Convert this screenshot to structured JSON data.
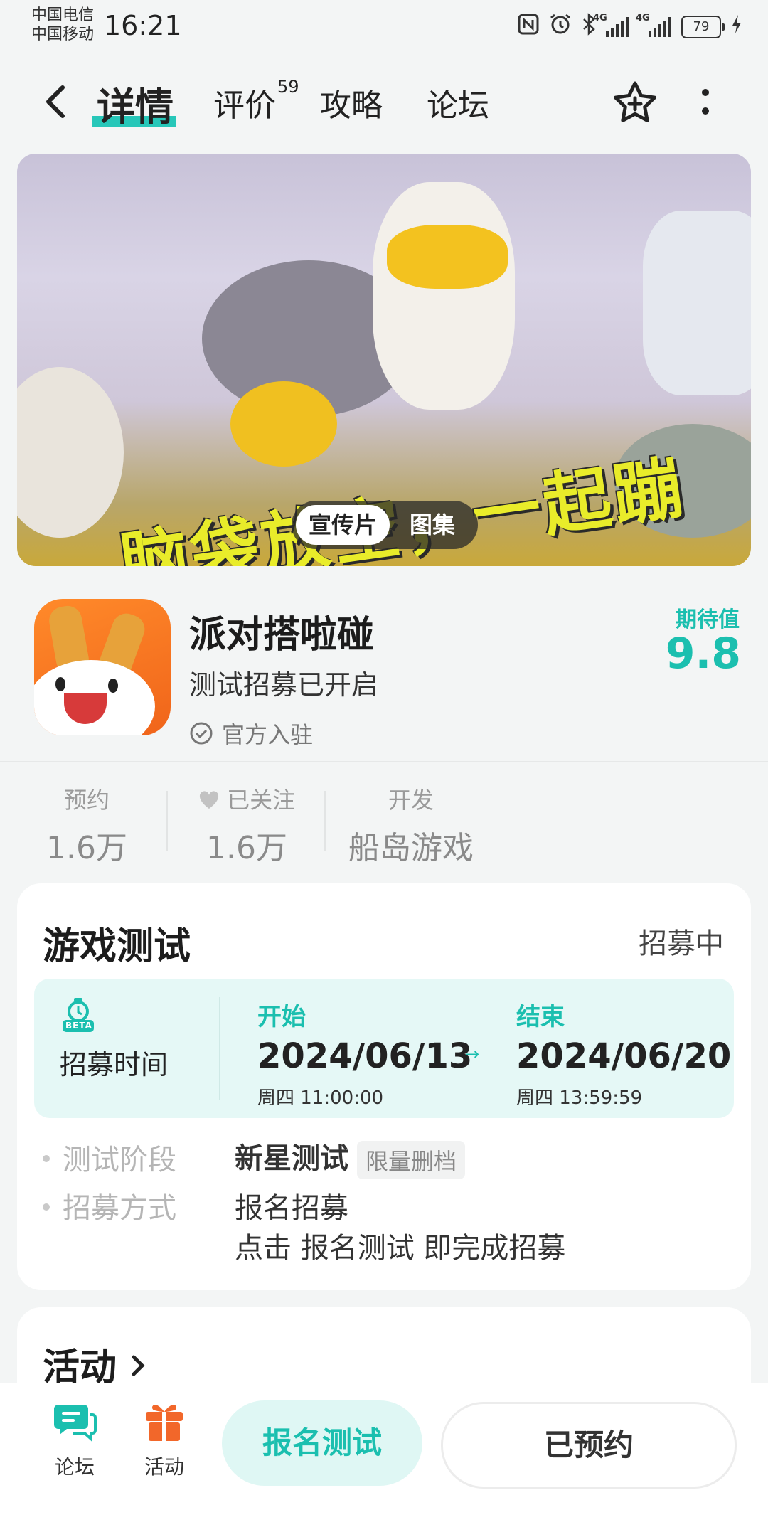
{
  "status_bar": {
    "carrier1": "中国电信",
    "carrier2": "中国移动",
    "time": "16:21",
    "net1": "4G",
    "net2": "4G",
    "battery": "79"
  },
  "nav": {
    "tabs": [
      {
        "label": "详情",
        "active": true
      },
      {
        "label": "评价",
        "badge": "59"
      },
      {
        "label": "攻略"
      },
      {
        "label": "论坛"
      }
    ]
  },
  "banner": {
    "headline": "脑袋放空，一起蹦蹦！",
    "segments": [
      "宣传片",
      "图集"
    ]
  },
  "game": {
    "name": "派对搭啦碰",
    "subtitle": "测试招募已开启",
    "official": "官方入驻",
    "expect_label": "期待值",
    "expect_value": "9.8"
  },
  "stats": [
    {
      "label": "预约",
      "value": "1.6万"
    },
    {
      "label": "已关注",
      "value": "1.6万"
    },
    {
      "label": "开发",
      "value": "船岛游戏"
    }
  ],
  "test_card": {
    "title": "游戏测试",
    "status": "招募中",
    "beta": "BETA",
    "time_label": "招募时间",
    "start": {
      "head": "开始",
      "date": "2024/06/13",
      "detail": "周四  11:00:00"
    },
    "end": {
      "head": "结束",
      "date": "2024/06/20",
      "detail": "周四  13:59:59"
    },
    "stage_label": "测试阶段",
    "stage_value": "新星测试",
    "stage_chip": "限量删档",
    "method_label": "招募方式",
    "method_value": "报名招募",
    "method_hint": "点击 报名测试 即完成招募"
  },
  "activity": {
    "title": "活动"
  },
  "bottom": {
    "forum": "论坛",
    "events": "活动",
    "join_button": "报名测试",
    "reserved_button": "已预约"
  },
  "colors": {
    "accent": "#1bbfaf",
    "accent_bg": "#e5f8f6",
    "gift": "#f2672a"
  }
}
